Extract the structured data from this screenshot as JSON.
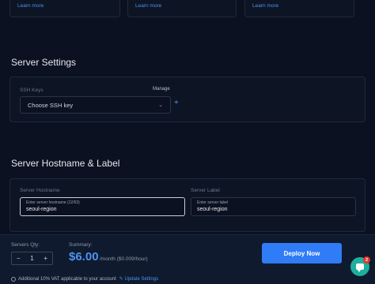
{
  "top_cards": [
    {
      "link": "Learn more"
    },
    {
      "link": "Learn more"
    },
    {
      "link": "Learn more"
    }
  ],
  "server_settings": {
    "title": "Server Settings",
    "ssh_label": "SSH Keys",
    "manage_label": "Manage",
    "ssh_select_value": "Choose SSH key",
    "add_symbol": "+"
  },
  "hostname_label": {
    "title": "Server Hostname & Label",
    "hostname_label": "Server Hostname",
    "hostname_hint": "Enter server hostname (12/63)",
    "hostname_value": "seoul-region",
    "label_label": "Server Label",
    "label_hint": "Enter server label",
    "label_value": "seoul-region"
  },
  "footer": {
    "qty_label": "Servers Qty:",
    "qty_minus": "−",
    "qty_value": "1",
    "qty_plus": "+",
    "summary_label": "Summary:",
    "price": "$6.00",
    "price_sub": "/month ($0.009/hour)",
    "deploy_label": "Deploy Now",
    "vat_text": "Additional 10% VAT applicable to your account",
    "update_settings": "✎ Update Settings"
  },
  "chat": {
    "badge": "2"
  }
}
